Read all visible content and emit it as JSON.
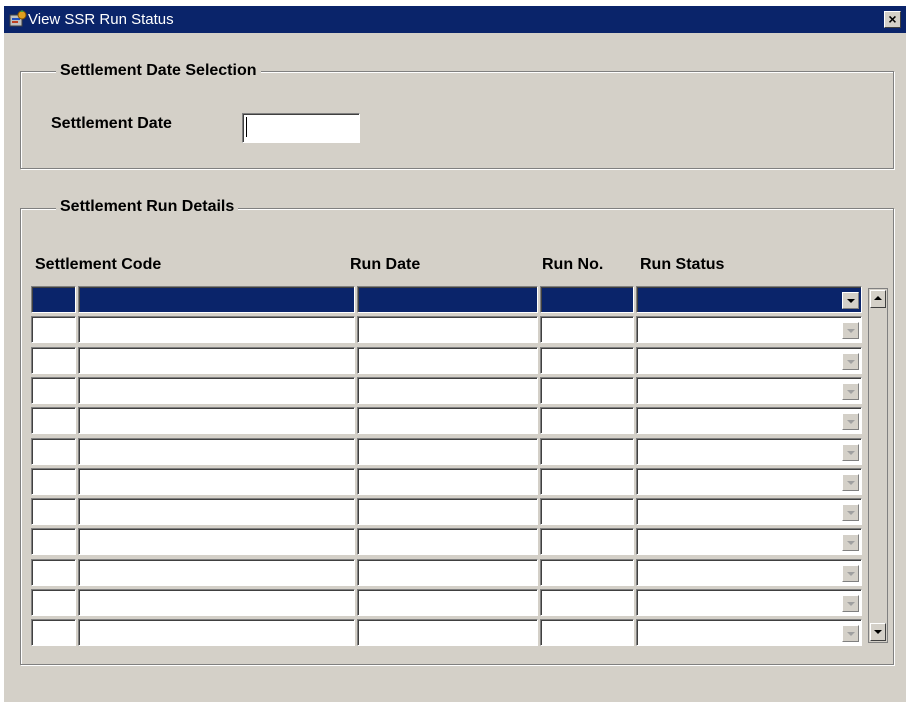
{
  "window": {
    "title": "View SSR Run Status",
    "close_label": "×"
  },
  "date_selection": {
    "group_title": "Settlement Date Selection",
    "date_label": "Settlement Date",
    "date_value": ""
  },
  "run_details": {
    "group_title": "Settlement Run Details",
    "columns": [
      "Settlement Code",
      "Run Date",
      "Run No.",
      "Run Status"
    ],
    "rows": [
      {
        "selected": true,
        "code": "",
        "run_date": "",
        "run_no": "",
        "run_status": ""
      },
      {
        "selected": false,
        "code": "",
        "run_date": "",
        "run_no": "",
        "run_status": ""
      },
      {
        "selected": false,
        "code": "",
        "run_date": "",
        "run_no": "",
        "run_status": ""
      },
      {
        "selected": false,
        "code": "",
        "run_date": "",
        "run_no": "",
        "run_status": ""
      },
      {
        "selected": false,
        "code": "",
        "run_date": "",
        "run_no": "",
        "run_status": ""
      },
      {
        "selected": false,
        "code": "",
        "run_date": "",
        "run_no": "",
        "run_status": ""
      },
      {
        "selected": false,
        "code": "",
        "run_date": "",
        "run_no": "",
        "run_status": ""
      },
      {
        "selected": false,
        "code": "",
        "run_date": "",
        "run_no": "",
        "run_status": ""
      },
      {
        "selected": false,
        "code": "",
        "run_date": "",
        "run_no": "",
        "run_status": ""
      },
      {
        "selected": false,
        "code": "",
        "run_date": "",
        "run_no": "",
        "run_status": ""
      },
      {
        "selected": false,
        "code": "",
        "run_date": "",
        "run_no": "",
        "run_status": ""
      },
      {
        "selected": false,
        "code": "",
        "run_date": "",
        "run_no": "",
        "run_status": ""
      }
    ]
  },
  "icons": {
    "window_icon": "oracle-forms-window-icon",
    "close": "close-icon",
    "dropdown": "chevron-down-icon",
    "scroll_up": "scroll-up-arrow-icon",
    "scroll_down": "scroll-down-arrow-icon"
  },
  "colors": {
    "titlebar": "#0a246a",
    "selected_row": "#0a246a",
    "panel": "#d4d0c8"
  }
}
